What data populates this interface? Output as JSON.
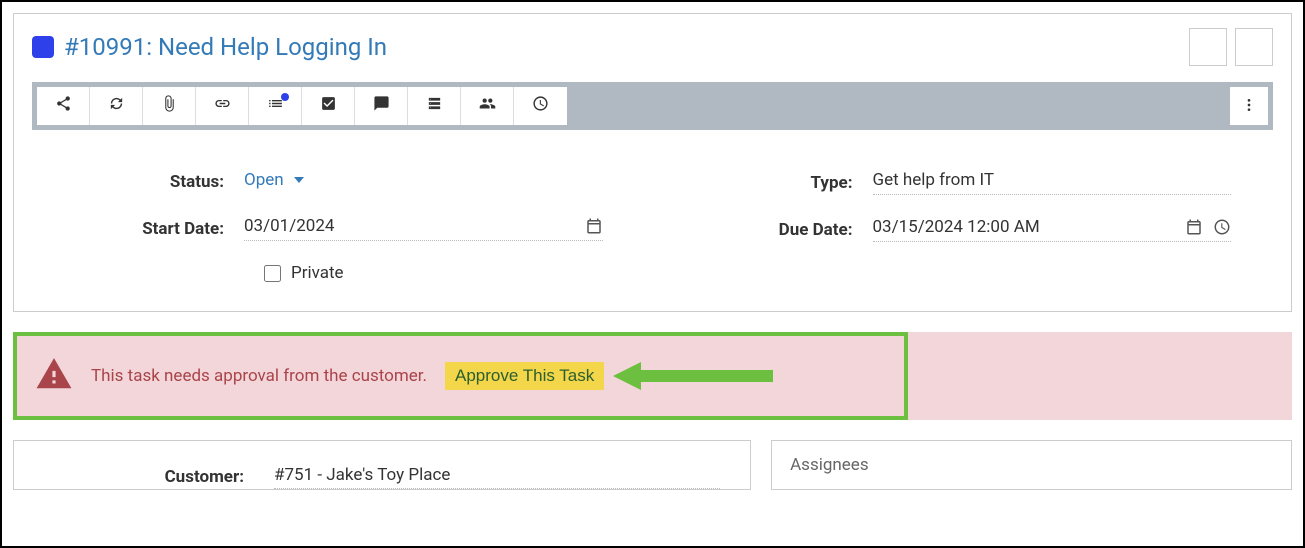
{
  "header": {
    "task_id": "#10991",
    "task_title": "Need Help Logging In",
    "title_display": "#10991: Need Help Logging In"
  },
  "toolbar": {
    "icons": [
      "share",
      "refresh",
      "attach",
      "link",
      "list",
      "check",
      "comment",
      "server",
      "users",
      "clock"
    ]
  },
  "fields": {
    "status_label": "Status:",
    "status_value": "Open",
    "start_date_label": "Start Date:",
    "start_date_value": "03/01/2024",
    "private_label": "Private",
    "private_checked": false,
    "type_label": "Type:",
    "type_value": "Get help from IT",
    "due_date_label": "Due Date:",
    "due_date_value": "03/15/2024 12:00 AM"
  },
  "alert": {
    "message": "This task needs approval from the customer.",
    "button_label": "Approve This Task"
  },
  "customer": {
    "label": "Customer:",
    "value": "#751 - Jake's Toy Place"
  },
  "assignees": {
    "title": "Assignees"
  }
}
